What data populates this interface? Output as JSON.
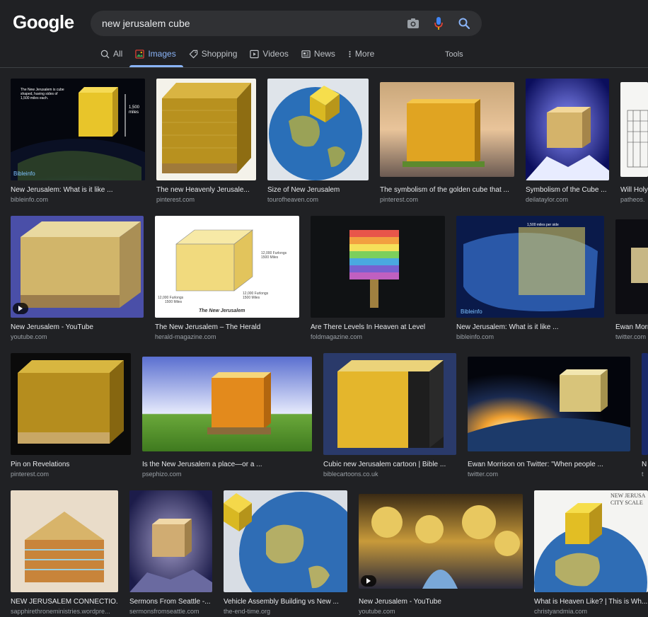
{
  "header": {
    "logo": "Google",
    "query": "new jerusalem cube",
    "tabs": [
      {
        "label": "All",
        "icon": "search-icon"
      },
      {
        "label": "Images",
        "icon": "image-icon"
      },
      {
        "label": "Shopping",
        "icon": "tag-icon"
      },
      {
        "label": "Videos",
        "icon": "play-icon"
      },
      {
        "label": "News",
        "icon": "newspaper-icon"
      },
      {
        "label": "More",
        "icon": "dots-vertical-icon"
      }
    ],
    "tools": "Tools"
  },
  "colors": {
    "accent": "#8ab4f8",
    "background": "#202124"
  },
  "results": [
    {
      "title": "New Jerusalem: What is it like ...",
      "source": "bibleinfo.com",
      "overlay": [
        "The New Jerusalem is cube",
        "shaped, having sides of",
        "1,500 miles each.",
        "1,500",
        "miles",
        "Bibleinfo"
      ]
    },
    {
      "title": "The new Heavenly Jerusale...",
      "source": "pinterest.com"
    },
    {
      "title": "Size of New Jerusalem",
      "source": "tourofheaven.com"
    },
    {
      "title": "The symbolism of the golden cube that ...",
      "source": "pinterest.com"
    },
    {
      "title": "Symbolism of the Cube ...",
      "source": "deilataylor.com"
    },
    {
      "title": "Will Holy",
      "source": "patheos."
    },
    {
      "title": "New Jerusalem - YouTube",
      "source": "youtube.com"
    },
    {
      "title": "The New Jerusalem – The Herald",
      "source": "herald-magazine.com",
      "overlay": [
        "12,000 Furlongs",
        "1500 Miles",
        "12,000 Furlongs",
        "1500 Miles",
        "12,000 Furlongs",
        "1500 Miles",
        "The New Jerusalem"
      ]
    },
    {
      "title": "Are There Levels In Heaven at Level",
      "source": "foldmagazine.com"
    },
    {
      "title": "New Jerusalem: What is it like ...",
      "source": "bibleinfo.com",
      "overlay": [
        "1,500 miles per side",
        "Bibleinfo"
      ]
    },
    {
      "title": "Ewan Morr",
      "source": "twitter.com"
    },
    {
      "title": "Pin on Revelations",
      "source": "pinterest.com"
    },
    {
      "title": "Is the New Jerusalem a place—or a ...",
      "source": "psephizo.com"
    },
    {
      "title": "Cubic new Jerusalem cartoon | Bible ...",
      "source": "biblecartoons.co.uk"
    },
    {
      "title": "Ewan Morrison on Twitter: \"When people ...",
      "source": "twitter.com"
    },
    {
      "title": "N",
      "source": "t"
    },
    {
      "title": "NEW JERUSALEM CONNECTIO...",
      "source": "sapphirethroneministries.wordpre..."
    },
    {
      "title": "Sermons From Seattle -...",
      "source": "sermonsfromseattle.com"
    },
    {
      "title": "Vehicle Assembly Building vs New ...",
      "source": "the-end-time.org"
    },
    {
      "title": "New Jerusalem - YouTube",
      "source": "youtube.com"
    },
    {
      "title": "What is Heaven Like? | This is Wh...",
      "source": "christyandmia.com",
      "overlay": [
        "NEW JERUSA",
        "CITY SCALE"
      ]
    }
  ]
}
